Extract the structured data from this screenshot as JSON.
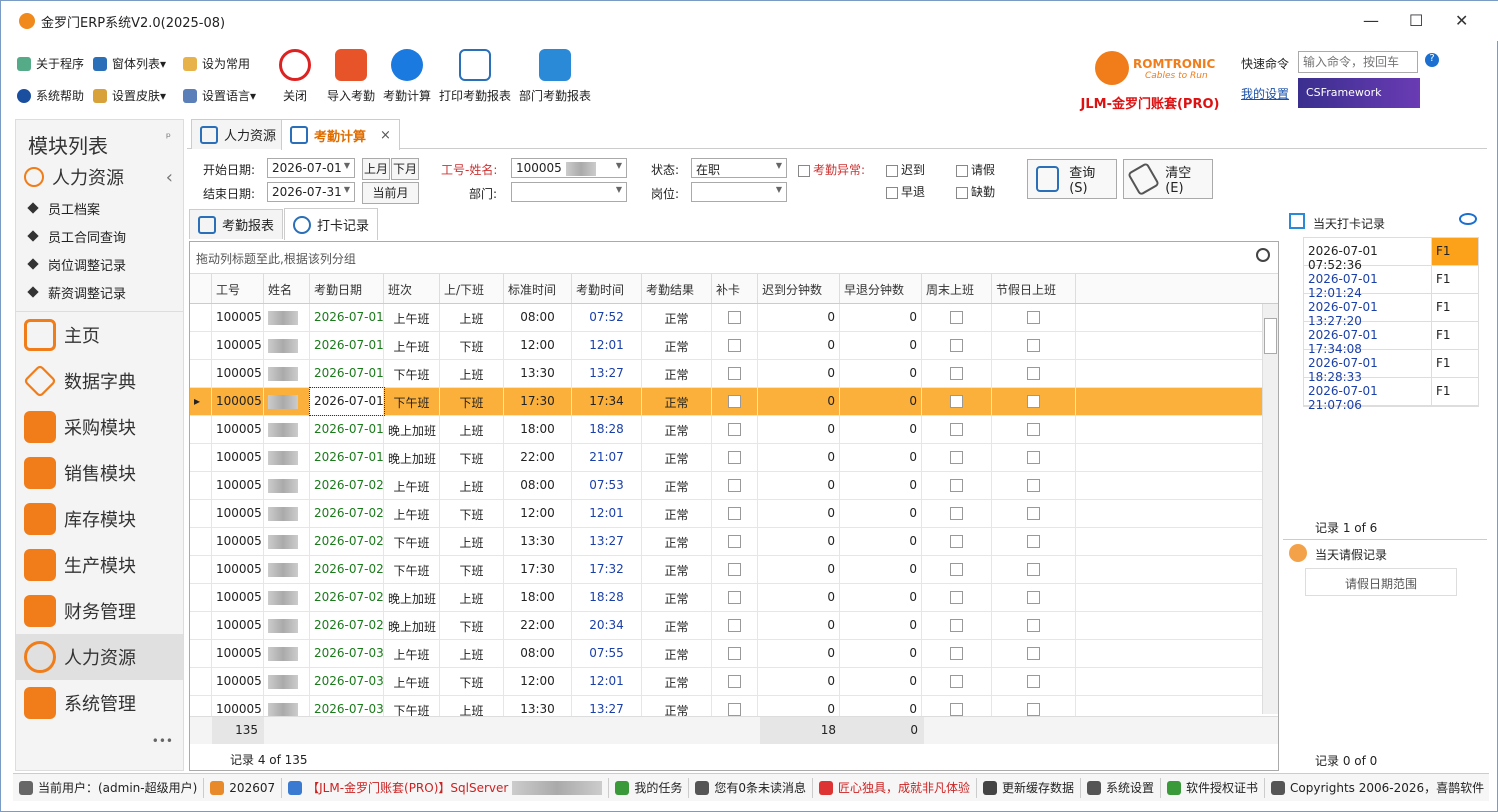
{
  "app": {
    "title": "金罗门ERP系统V2.0(2025-08)",
    "minimize": "—",
    "maximize": "☐",
    "close": "✕"
  },
  "ribbon": {
    "small": [
      {
        "label": "关于程序",
        "icon": "help-circle-icon"
      },
      {
        "label": "窗体列表",
        "icon": "windows-icon"
      },
      {
        "label": "设为常用",
        "icon": "clipboard-icon"
      },
      {
        "label": "系统帮助",
        "icon": "question-icon"
      },
      {
        "label": "设置皮肤",
        "icon": "skin-icon"
      },
      {
        "label": "设置语言",
        "icon": "language-icon"
      }
    ],
    "big": [
      {
        "label": "关闭",
        "icon": "power-icon"
      },
      {
        "label": "导入考勤",
        "icon": "import-icon"
      },
      {
        "label": "考勤计算",
        "icon": "calculate-icon"
      },
      {
        "label": "打印考勤报表",
        "icon": "print-report-icon"
      },
      {
        "label": "部门考勤报表",
        "icon": "dept-report-icon"
      }
    ],
    "brand_name": "ROMTRONIC",
    "brand_slogan": "Cables to Run",
    "brand_title": "JLM-金罗门账套(PRO)",
    "quick_cmd_label": "快速命令",
    "quick_cmd_placeholder": "输入命令，按回车",
    "my_settings": "我的设置",
    "csframework": "CSFramework"
  },
  "sidebar": {
    "title": "模块列表",
    "pin": "ᵖ",
    "section": "人力资源",
    "collapse": "‹",
    "subs": [
      "员工档案",
      "员工合同查询",
      "岗位调整记录",
      "薪资调整记录"
    ],
    "modules": [
      {
        "label": "主页",
        "color": "#f07d1a"
      },
      {
        "label": "数据字典",
        "color": "#f07d1a"
      },
      {
        "label": "采购模块",
        "color": "#f07d1a"
      },
      {
        "label": "销售模块",
        "color": "#f07d1a"
      },
      {
        "label": "库存模块",
        "color": "#f07d1a"
      },
      {
        "label": "生产模块",
        "color": "#f07d1a"
      },
      {
        "label": "财务管理",
        "color": "#f07d1a"
      },
      {
        "label": "人力资源",
        "color": "#f07d1a"
      },
      {
        "label": "系统管理",
        "color": "#f07d1a"
      }
    ],
    "more": "•••"
  },
  "tabs": [
    {
      "label": "人力资源"
    },
    {
      "label": "考勤计算",
      "close": "×"
    }
  ],
  "filter": {
    "start_label": "开始日期:",
    "start": "2026-07-01",
    "end_label": "结束日期:",
    "end": "2026-07-31",
    "prev_month": "上月",
    "next_month": "下月",
    "cur_month": "当前月",
    "emp_label": "工号-姓名:",
    "emp_value": "100005",
    "dept_label": "部门:",
    "status_label": "状态:",
    "status_value": "在职",
    "post_label": "岗位:",
    "abnormal_label": "考勤异常:",
    "late": "迟到",
    "early": "早退",
    "leave": "请假",
    "absent": "缺勤",
    "query": "查询(S)",
    "clear": "清空(E)"
  },
  "subtabs": [
    {
      "label": "考勤报表"
    },
    {
      "label": "打卡记录"
    }
  ],
  "grid": {
    "group_hint": "拖动列标题至此,根据该列分组",
    "columns": [
      "工号",
      "姓名",
      "考勤日期",
      "班次",
      "上/下班",
      "标准时间",
      "考勤时间",
      "考勤结果",
      "补卡",
      "迟到分钟数",
      "早退分钟数",
      "周末上班",
      "节假日上班"
    ],
    "rows": [
      [
        "100005",
        "2026-07-01",
        "上午班",
        "上班",
        "08:00",
        "07:52",
        "正常",
        "0",
        "0"
      ],
      [
        "100005",
        "2026-07-01",
        "上午班",
        "下班",
        "12:00",
        "12:01",
        "正常",
        "0",
        "0"
      ],
      [
        "100005",
        "2026-07-01",
        "下午班",
        "上班",
        "13:30",
        "13:27",
        "正常",
        "0",
        "0"
      ],
      [
        "100005",
        "2026-07-01",
        "下午班",
        "下班",
        "17:30",
        "17:34",
        "正常",
        "0",
        "0"
      ],
      [
        "100005",
        "2026-07-01",
        "晚上加班",
        "上班",
        "18:00",
        "18:28",
        "正常",
        "0",
        "0"
      ],
      [
        "100005",
        "2026-07-01",
        "晚上加班",
        "下班",
        "22:00",
        "21:07",
        "正常",
        "0",
        "0"
      ],
      [
        "100005",
        "2026-07-02",
        "上午班",
        "上班",
        "08:00",
        "07:53",
        "正常",
        "0",
        "0"
      ],
      [
        "100005",
        "2026-07-02",
        "上午班",
        "下班",
        "12:00",
        "12:01",
        "正常",
        "0",
        "0"
      ],
      [
        "100005",
        "2026-07-02",
        "下午班",
        "上班",
        "13:30",
        "13:27",
        "正常",
        "0",
        "0"
      ],
      [
        "100005",
        "2026-07-02",
        "下午班",
        "下班",
        "17:30",
        "17:32",
        "正常",
        "0",
        "0"
      ],
      [
        "100005",
        "2026-07-02",
        "晚上加班",
        "上班",
        "18:00",
        "18:28",
        "正常",
        "0",
        "0"
      ],
      [
        "100005",
        "2026-07-02",
        "晚上加班",
        "下班",
        "22:00",
        "20:34",
        "正常",
        "0",
        "0"
      ],
      [
        "100005",
        "2026-07-03",
        "上午班",
        "上班",
        "08:00",
        "07:55",
        "正常",
        "0",
        "0"
      ],
      [
        "100005",
        "2026-07-03",
        "上午班",
        "下班",
        "12:00",
        "12:01",
        "正常",
        "0",
        "0"
      ],
      [
        "100005",
        "2026-07-03",
        "下午班",
        "上班",
        "13:30",
        "13:27",
        "正常",
        "0",
        "0"
      ]
    ],
    "selected_index": 3,
    "footer_count": "135",
    "footer_late": "18",
    "footer_early": "0",
    "nav": "记录 4 of 135"
  },
  "punch": {
    "title": "当天打卡记录",
    "rows": [
      [
        "2026-07-01 07:52:36",
        "F1"
      ],
      [
        "2026-07-01 12:01:24",
        "F1"
      ],
      [
        "2026-07-01 13:27:20",
        "F1"
      ],
      [
        "2026-07-01 17:34:08",
        "F1"
      ],
      [
        "2026-07-01 18:28:33",
        "F1"
      ],
      [
        "2026-07-01 21:07:06",
        "F1"
      ]
    ],
    "nav": "记录 1 of 6"
  },
  "leave": {
    "title": "当天请假记录",
    "column": "请假日期范围",
    "nav": "记录 0 of 0"
  },
  "status": {
    "user": "当前用户：(admin-超级用户)",
    "period": "202607",
    "db": "【JLM-金罗门账套(PRO)】SqlServer",
    "tasks": "我的任务",
    "msgs": "您有0条未读消息",
    "slogan": "匠心独具，成就非凡体验",
    "cache": "更新缓存数据",
    "sys": "系统设置",
    "license": "软件授权证书",
    "copyright": "Copyrights 2006-2026，喜鹊软件"
  }
}
